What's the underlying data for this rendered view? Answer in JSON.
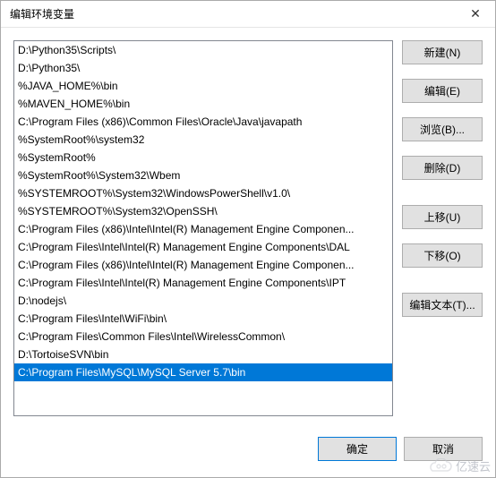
{
  "titlebar": {
    "title": "编辑环境变量"
  },
  "list": {
    "items": [
      "D:\\Python35\\Scripts\\",
      "D:\\Python35\\",
      "%JAVA_HOME%\\bin",
      "%MAVEN_HOME%\\bin",
      "C:\\Program Files (x86)\\Common Files\\Oracle\\Java\\javapath",
      "%SystemRoot%\\system32",
      "%SystemRoot%",
      "%SystemRoot%\\System32\\Wbem",
      "%SYSTEMROOT%\\System32\\WindowsPowerShell\\v1.0\\",
      "%SYSTEMROOT%\\System32\\OpenSSH\\",
      "C:\\Program Files (x86)\\Intel\\Intel(R) Management Engine Componen...",
      "C:\\Program Files\\Intel\\Intel(R) Management Engine Components\\DAL",
      "C:\\Program Files (x86)\\Intel\\Intel(R) Management Engine Componen...",
      "C:\\Program Files\\Intel\\Intel(R) Management Engine Components\\IPT",
      "D:\\nodejs\\",
      "C:\\Program Files\\Intel\\WiFi\\bin\\",
      "C:\\Program Files\\Common Files\\Intel\\WirelessCommon\\",
      "D:\\TortoiseSVN\\bin",
      "C:\\Program Files\\MySQL\\MySQL Server 5.7\\bin"
    ],
    "selected_index": 18
  },
  "buttons": {
    "new": "新建(N)",
    "edit": "编辑(E)",
    "browse": "浏览(B)...",
    "delete": "删除(D)",
    "move_up": "上移(U)",
    "move_down": "下移(O)",
    "edit_text": "编辑文本(T)...",
    "ok": "确定",
    "cancel": "取消"
  },
  "watermark": {
    "text": "亿速云"
  }
}
